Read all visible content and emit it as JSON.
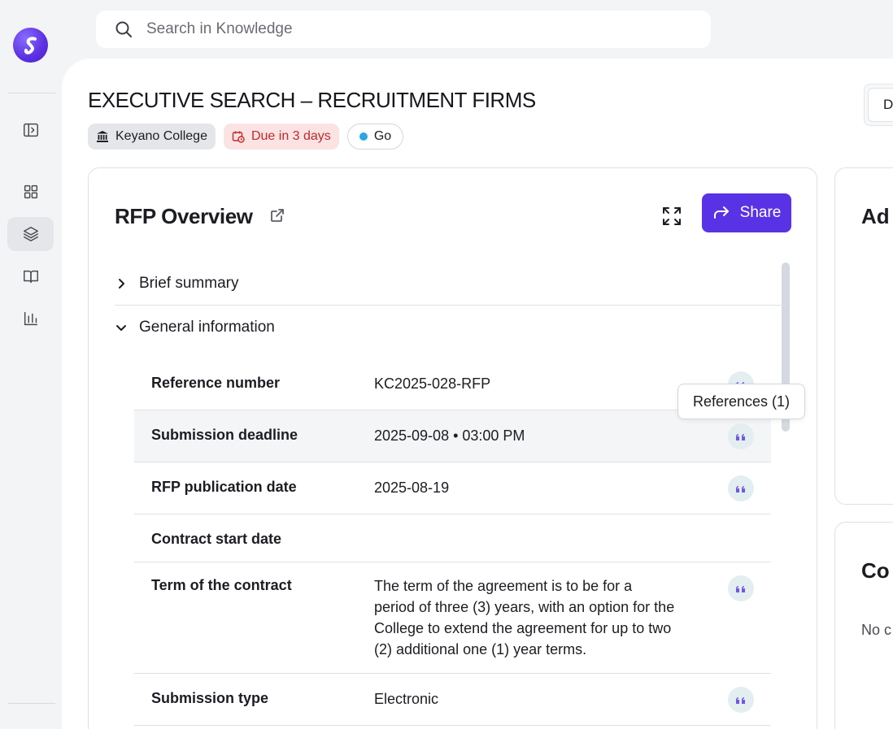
{
  "search": {
    "placeholder": "Search in Knowledge"
  },
  "page": {
    "title": "EXECUTIVE SEARCH – RECRUITMENT FIRMS",
    "chips": {
      "org": "Keyano College",
      "due": "Due in 3 days",
      "status": "Go"
    },
    "top_right_button": "Da"
  },
  "overview": {
    "title": "RFP Overview",
    "share_label": "Share",
    "sections": [
      {
        "label": "Brief summary",
        "expanded": false
      },
      {
        "label": "General information",
        "expanded": true
      }
    ],
    "rows": [
      {
        "label": "Reference number",
        "value": "KC2025-028-RFP"
      },
      {
        "label": "Submission deadline",
        "value": "2025-09-08 • 03:00 PM"
      },
      {
        "label": "RFP publication date",
        "value": "2025-08-19"
      },
      {
        "label": "Contract start date",
        "value": ""
      },
      {
        "label": "Term of the contract",
        "value": "The term of the agreement is to be for a period of three (3) years, with an option for the College to extend the agreement for up to two (2) additional one (1) year terms."
      },
      {
        "label": "Submission type",
        "value": "Electronic"
      }
    ],
    "tooltip": "References (1)"
  },
  "right_cards": {
    "first_title": "Ad",
    "second_title": "Co",
    "second_text": "No c"
  },
  "colors": {
    "accent": "#5a32e6",
    "due_text": "#c0292b",
    "due_bg": "#fbe3e3",
    "status_dot": "#2aa6e6"
  }
}
